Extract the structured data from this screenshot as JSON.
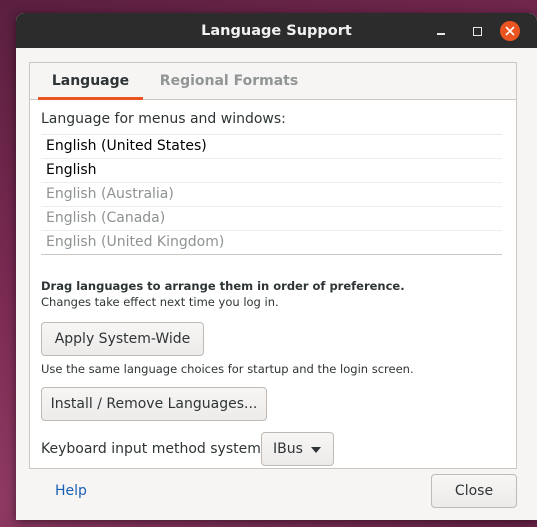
{
  "window": {
    "title": "Language Support"
  },
  "tabs": [
    {
      "label": "Language",
      "active": true
    },
    {
      "label": "Regional Formats",
      "active": false
    }
  ],
  "language_tab": {
    "section_label": "Language for menus and windows:",
    "languages": [
      {
        "label": "English (United States)",
        "enabled": true
      },
      {
        "label": "English",
        "enabled": true
      },
      {
        "label": "English (Australia)",
        "enabled": false
      },
      {
        "label": "English (Canada)",
        "enabled": false
      },
      {
        "label": "English (United Kingdom)",
        "enabled": false
      }
    ],
    "hint_bold": "Drag languages to arrange them in order of preference.",
    "hint": "Changes take effect next time you log in.",
    "apply_button": "Apply System-Wide",
    "apply_hint": "Use the same language choices for startup and the login screen.",
    "install_button": "Install / Remove Languages...",
    "keyboard_label": "Keyboard input method system:",
    "keyboard_value": "IBus"
  },
  "footer": {
    "help_link": "Help",
    "close_button": "Close"
  },
  "colors": {
    "accent": "#e95420",
    "link": "#1a5fb4",
    "titlebar": "#2c2c2c"
  }
}
